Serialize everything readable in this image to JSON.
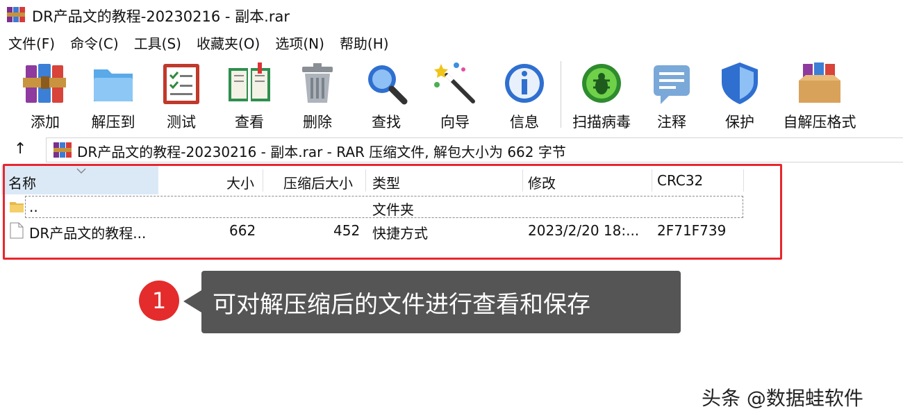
{
  "window": {
    "title": "DR产品文的教程-20230216 - 副本.rar"
  },
  "menu": [
    "文件(F)",
    "命令(C)",
    "工具(S)",
    "收藏夹(O)",
    "选项(N)",
    "帮助(H)"
  ],
  "toolbar": {
    "add": "添加",
    "extract": "解压到",
    "test": "测试",
    "view": "查看",
    "delete": "删除",
    "find": "查找",
    "wizard": "向导",
    "info": "信息",
    "virus_scan": "扫描病毒",
    "comment": "注释",
    "protect": "保护",
    "sfx": "自解压格式"
  },
  "address": {
    "up": "↑",
    "text": "DR产品文的教程-20230216 - 副本.rar - RAR 压缩文件, 解包大小为 662 字节"
  },
  "columns": {
    "name": "名称",
    "size": "大小",
    "packed": "压缩后大小",
    "type": "类型",
    "modified": "修改",
    "crc": "CRC32"
  },
  "rows": [
    {
      "name": "..",
      "size": "",
      "packed": "",
      "type": "文件夹",
      "modified": "",
      "crc": ""
    },
    {
      "name": "DR产品文的教程...",
      "size": "662",
      "packed": "452",
      "type": "快捷方式",
      "modified": "2023/2/20 18:...",
      "crc": "2F71F739"
    }
  ],
  "callout": {
    "number": "1",
    "text": "可对解压缩后的文件进行查看和保存"
  },
  "watermark": "头条 @数据蛙软件",
  "colors": {
    "highlight": "#e8262d",
    "callout_bg": "#555555",
    "badge": "#e42c2c",
    "header_selected": "#dbe9f7"
  }
}
